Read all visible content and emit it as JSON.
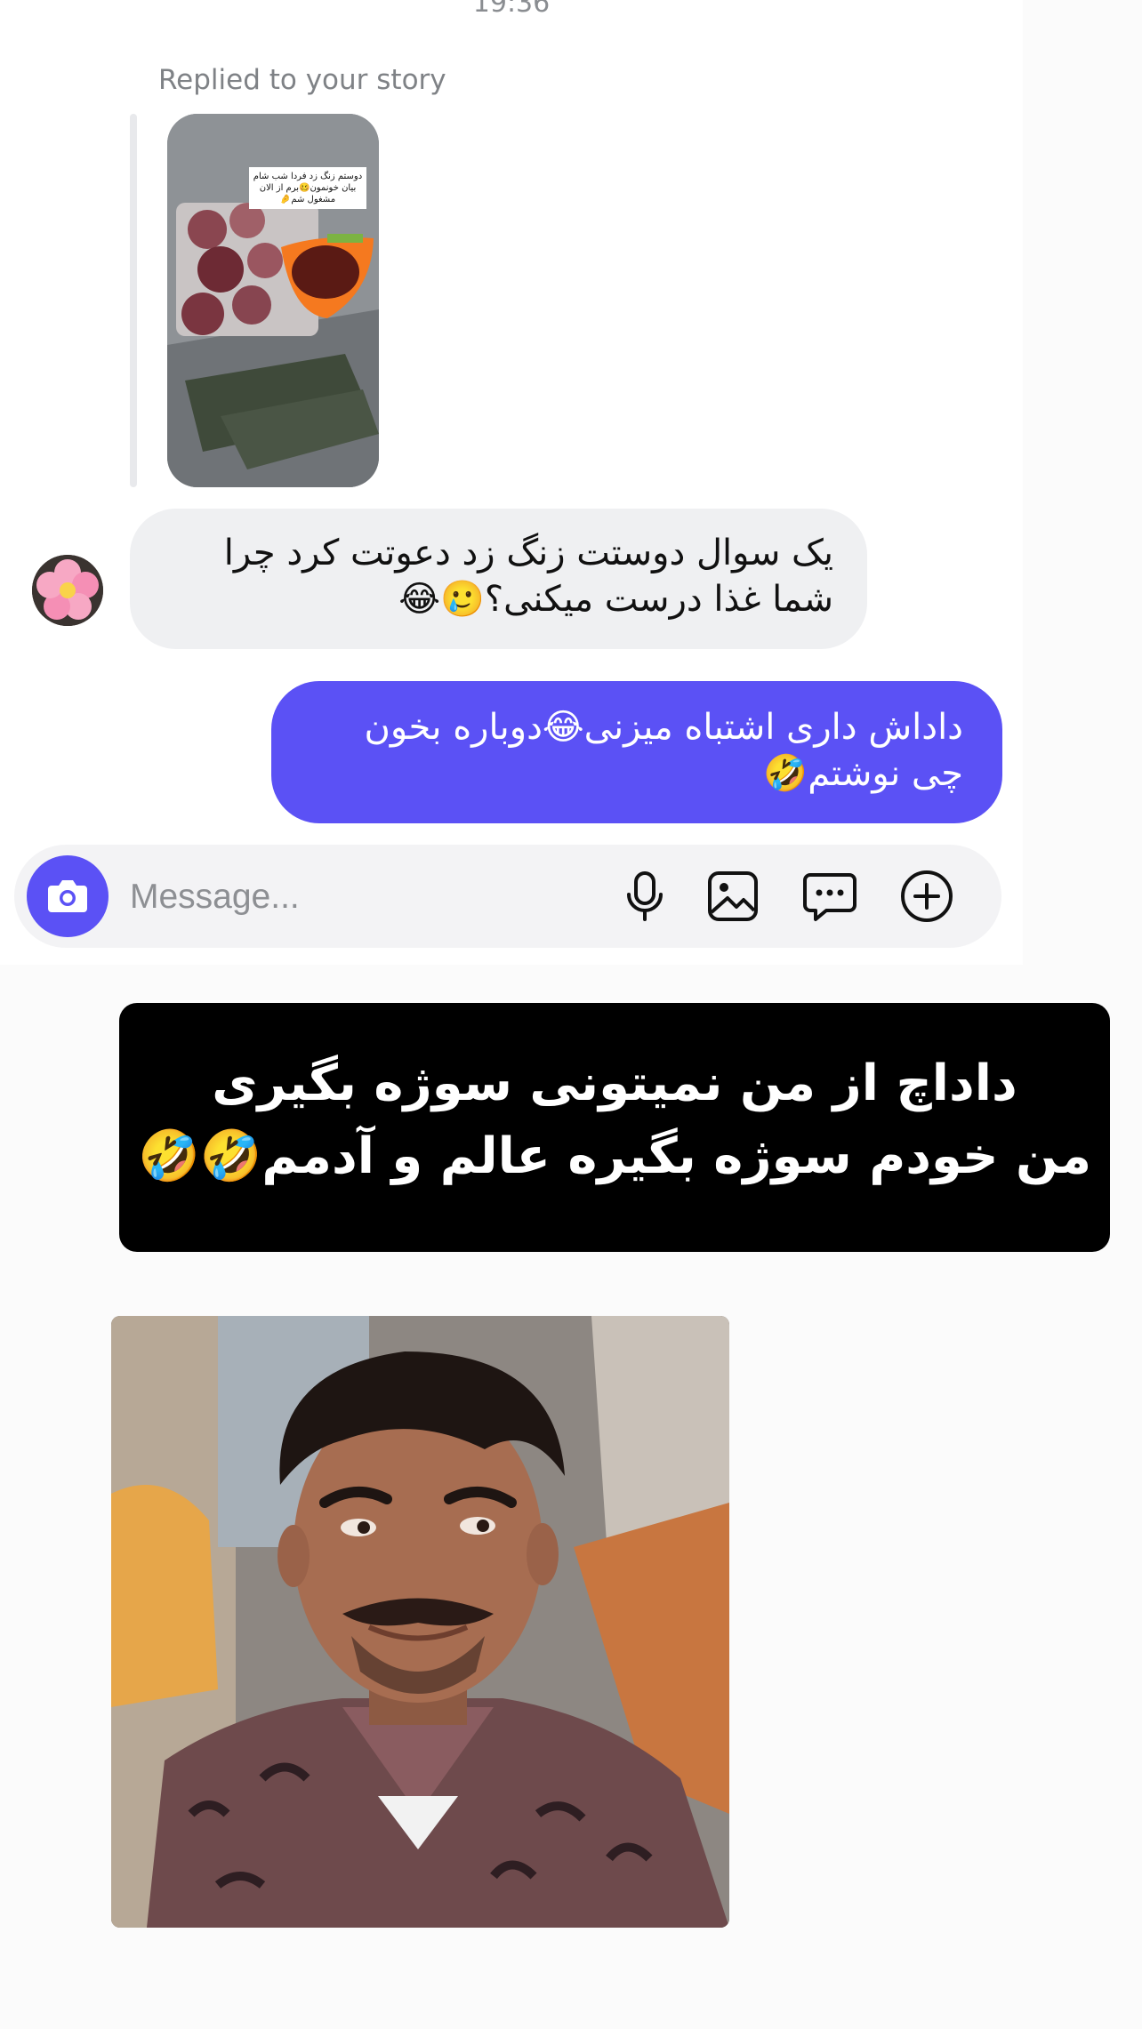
{
  "timestamp": "19:36",
  "story_reply": {
    "label": "Replied to your story",
    "thumb_caption": "دوستم زنگ زد فردا شب شام بیان خونمون🥴برم از الان مشغول شم🤌"
  },
  "messages": [
    {
      "direction": "incoming",
      "text": "یک سوال دوستت زنگ زد دعوتت کرد چرا شما غذا درست میکنی؟🥲😂"
    },
    {
      "direction": "outgoing",
      "text": "داداش داری اشتباه میزنی😂دوباره بخون چی نوشتم🤣"
    }
  ],
  "composer": {
    "placeholder": "Message...",
    "icons": [
      "camera-icon",
      "microphone-icon",
      "gallery-icon",
      "chat-bubble-icon",
      "plus-circle-icon"
    ]
  },
  "meme": {
    "line1": "داداچ از من نمیتونی سوژه بگیری",
    "line2": "من خودم سوژه بگیره عالم و آدمم🤣🤣"
  },
  "colors": {
    "accent": "#5b51f5",
    "incoming_bubble": "#eff0f2",
    "composer_bg": "#f3f3f5",
    "meme_bg": "#000000"
  }
}
